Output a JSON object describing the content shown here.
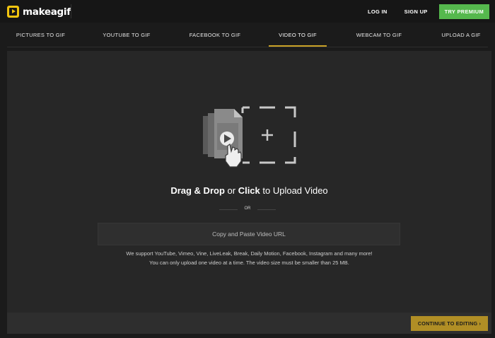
{
  "header": {
    "logo_text": "makeagif",
    "login_label": "LOG IN",
    "signup_label": "SIGN UP",
    "premium_label": "TRY PREMIUM"
  },
  "tabs": [
    {
      "label": "PICTURES TO GIF"
    },
    {
      "label": "YOUTUBE TO GIF"
    },
    {
      "label": "FACEBOOK TO GIF"
    },
    {
      "label": "VIDEO TO GIF",
      "active": true
    },
    {
      "label": "WEBCAM TO GIF"
    },
    {
      "label": "UPLOAD A GIF"
    }
  ],
  "upload": {
    "title_drag": "Drag & Drop",
    "title_or": " or ",
    "title_click": "Click",
    "title_rest": " to Upload Video",
    "or_label": "OR",
    "url_placeholder": "Copy and Paste Video URL",
    "support_line1": "We support YouTube, Vimeo, Vine, LiveLeak, Break, Daily Motion, Facebook, Instagram and many more!",
    "support_line2": "You can only upload one video at a time. The video size must be smaller than 25 MB."
  },
  "footer": {
    "continue_label": "CONTINUE TO EDITING",
    "continue_icon": "chevron-right-icon"
  },
  "colors": {
    "brand_yellow": "#f1c40f",
    "premium_green": "#55b84d",
    "active_tab_underline": "#c9a227",
    "continue_button": "#b08e25",
    "background": "#1b1b1b",
    "panel": "#272727"
  }
}
